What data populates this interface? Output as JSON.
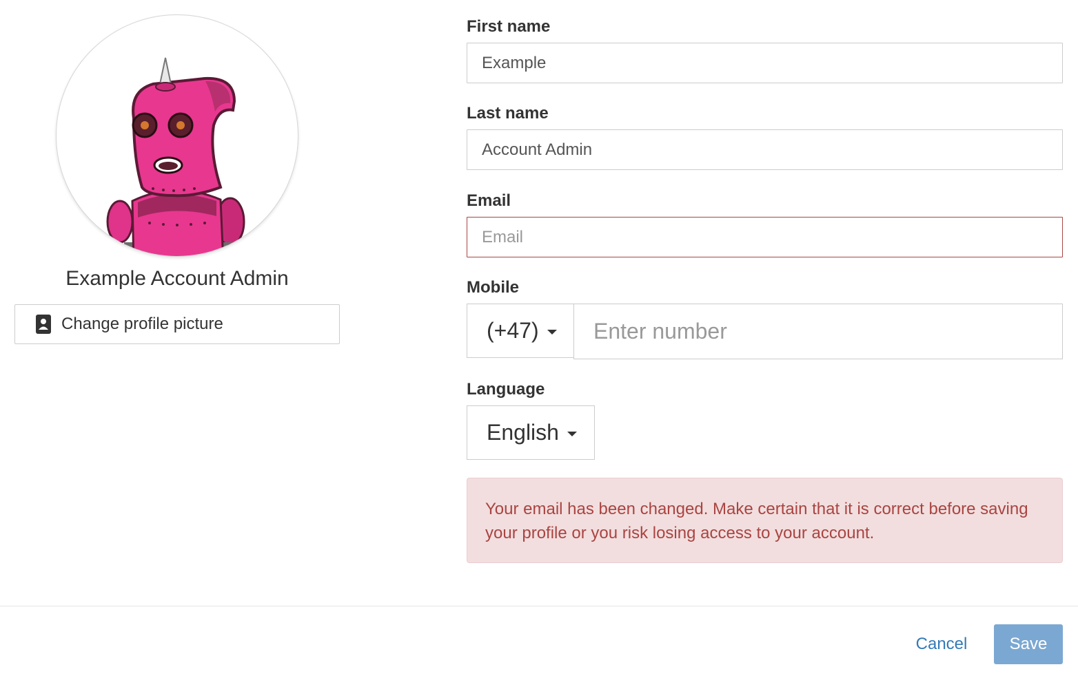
{
  "profile": {
    "full_name": "Example Account Admin",
    "change_picture_label": "Change profile picture",
    "avatar_icon": "robot-avatar"
  },
  "form": {
    "first_name": {
      "label": "First name",
      "value": "Example",
      "placeholder": ""
    },
    "last_name": {
      "label": "Last name",
      "value": "Account Admin",
      "placeholder": ""
    },
    "email": {
      "label": "Email",
      "value": "",
      "placeholder": "Email",
      "state": "error"
    },
    "mobile": {
      "label": "Mobile",
      "country_code": "(+47)",
      "value": "",
      "placeholder": "Enter number"
    },
    "language": {
      "label": "Language",
      "selected": "English"
    }
  },
  "alert": {
    "text": "Your email has been changed. Make certain that it is correct before saving your profile or you risk losing access to your account."
  },
  "footer": {
    "cancel_label": "Cancel",
    "save_label": "Save"
  },
  "colors": {
    "error_border": "#a94442",
    "alert_bg": "#f2dede",
    "alert_text": "#a94442",
    "link": "#337ab7",
    "save_disabled": "#7ba8d2"
  }
}
